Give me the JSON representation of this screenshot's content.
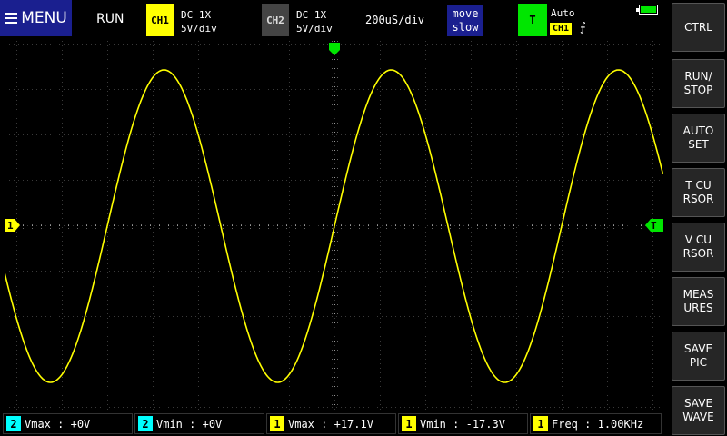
{
  "topbar": {
    "menu_label": "MENU",
    "run_status": "RUN",
    "ch1": {
      "tag": "CH1",
      "coupling": "DC  1X",
      "scale": "5V/div"
    },
    "ch2": {
      "tag": "CH2",
      "coupling": "DC  1X",
      "scale": "5V/div"
    },
    "timebase": "200uS/div",
    "move": {
      "line1": "move",
      "line2": "slow"
    },
    "trigger": {
      "tag": "T",
      "mode": "Auto",
      "source": "CH1",
      "edge": "⨍"
    }
  },
  "sidebar": {
    "buttons": [
      {
        "id": "ctrl",
        "label": "CTRL"
      },
      {
        "id": "run-stop",
        "label": "RUN/\nSTOP"
      },
      {
        "id": "auto-set",
        "label": "AUTO\nSET"
      },
      {
        "id": "t-cursor",
        "label": "T  CU\nRSOR"
      },
      {
        "id": "v-cursor",
        "label": "V  CU\nRSOR"
      },
      {
        "id": "measures",
        "label": "MEAS\nURES"
      },
      {
        "id": "save-pic",
        "label": "SAVE\nPIC"
      },
      {
        "id": "save-wave",
        "label": "SAVE\nWAVE"
      }
    ]
  },
  "markers": {
    "ch1_ground": "1",
    "trigger_level": "T"
  },
  "measurements": [
    {
      "channel": "2",
      "label": "Vmax",
      "value": "+0V"
    },
    {
      "channel": "2",
      "label": "Vmin",
      "value": "+0V"
    },
    {
      "channel": "1",
      "label": "Vmax",
      "value": "+17.1V"
    },
    {
      "channel": "1",
      "label": "Vmin",
      "value": "-17.3V"
    },
    {
      "channel": "1",
      "label": "Freq",
      "value": "1.00KHz"
    }
  ],
  "colors": {
    "ch1": "#ffff00",
    "ch2": "#00ffff",
    "trigger": "#00e600",
    "menu": "#1a1f8f"
  },
  "chart_data": {
    "type": "line",
    "series": [
      {
        "waveform": "sine",
        "frequency_hz": 1000,
        "vmax": 17.1,
        "vmin": -17.3
      }
    ],
    "timebase": "200uS/div",
    "vertical_scale": "5V/div",
    "grid": true
  }
}
